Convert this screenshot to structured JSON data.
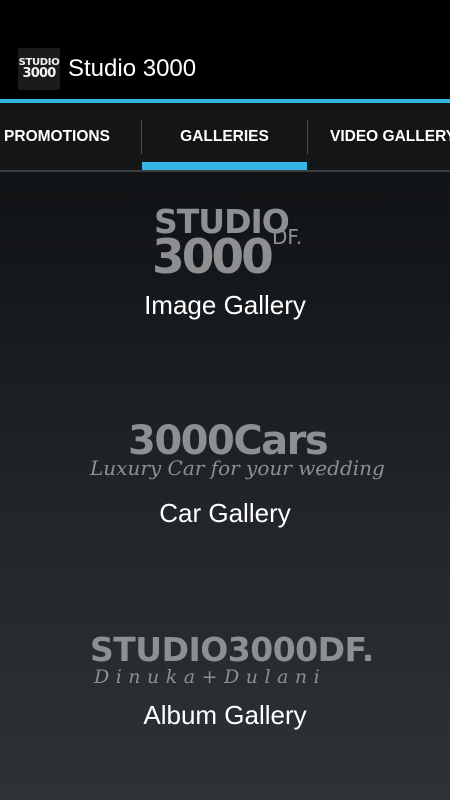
{
  "action_bar": {
    "app_icon_text": {
      "line1": "STUDIO",
      "line2": "3000"
    },
    "title": "Studio 3000",
    "accent_color": "#33b5e5"
  },
  "tabs": [
    {
      "label": "PROMOTIONS",
      "selected": false
    },
    {
      "label": "GALLERIES",
      "selected": true
    },
    {
      "label": "VIDEO GALLERY",
      "selected": false
    }
  ],
  "galleries": [
    {
      "label": "Image Gallery",
      "logo": {
        "line1": "STUDIO",
        "line2": "3000",
        "suffix": "DF."
      }
    },
    {
      "label": "Car Gallery",
      "logo": {
        "main": "3000Cars",
        "tagline": "Luxury Car for your wedding"
      }
    },
    {
      "label": "Album Gallery",
      "logo": {
        "main": "STUDIO3000DF.",
        "sub": "Dinuka+Dulani"
      }
    }
  ]
}
